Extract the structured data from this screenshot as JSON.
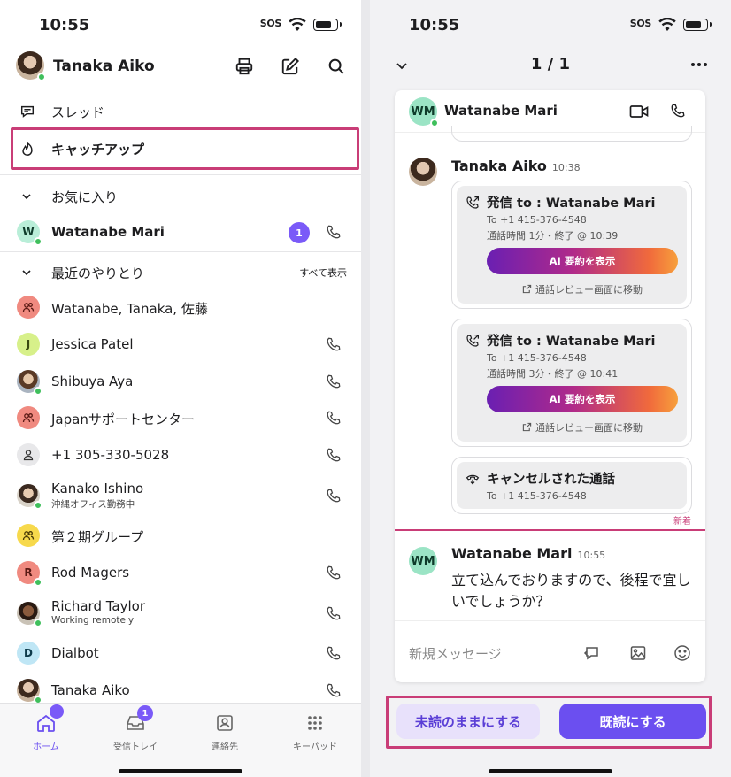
{
  "left": {
    "status": {
      "time": "10:55",
      "sos": "SOS"
    },
    "header": {
      "user_name": "Tanaka Aiko"
    },
    "nav": {
      "threads": "スレッド",
      "catchup": "キャッチアップ"
    },
    "favorites": {
      "title": "お気に入り",
      "items": [
        {
          "initial": "W",
          "name": "Watanabe Mari",
          "count": "1"
        }
      ]
    },
    "recent": {
      "title": "最近のやりとり",
      "see_all": "すべて表示",
      "items": [
        {
          "name": "Watanabe, Tanaka, 佐藤"
        },
        {
          "initial": "J",
          "name": "Jessica Patel"
        },
        {
          "name": "Shibuya Aya"
        },
        {
          "name": "Japanサポートセンター"
        },
        {
          "name": "+1 305-330-5028"
        },
        {
          "name": "Kanako Ishino",
          "sub": "沖縄オフィス勤務中"
        },
        {
          "name": "第２期グループ"
        },
        {
          "initial": "R",
          "name": "Rod Magers"
        },
        {
          "name": "Richard Taylor",
          "sub": "Working remotely"
        },
        {
          "initial": "D",
          "name": "Dialbot"
        },
        {
          "name": "Tanaka Aiko"
        }
      ]
    },
    "tabs": [
      {
        "label": "ホーム"
      },
      {
        "label": "受信トレイ",
        "badge": "1"
      },
      {
        "label": "連絡先"
      },
      {
        "label": "キーパッド"
      }
    ]
  },
  "right": {
    "status": {
      "time": "10:55",
      "sos": "SOS"
    },
    "header": {
      "page": "1 / 1"
    },
    "conversation": {
      "initials": "WM",
      "title": "Watanabe Mari"
    },
    "messages": {
      "first": {
        "sender": "Tanaka Aiko",
        "time": "10:38"
      },
      "calls": [
        {
          "title": "発信 to : Watanabe Mari",
          "to": "To +1 415-376-4548",
          "detail": "通話時間 1分・終了 @ 10:39",
          "ai_button": "AI 要約を表示",
          "review": "通話レビュー画面に移動"
        },
        {
          "title": "発信 to : Watanabe Mari",
          "to": "To +1 415-376-4548",
          "detail": "通話時間 3分・終了 @ 10:41",
          "ai_button": "AI 要約を表示",
          "review": "通話レビュー画面に移動"
        }
      ],
      "cancelled": {
        "title": "キャンセルされた通話",
        "to": "To +1 415-376-4548"
      },
      "new_label": "新着",
      "reply": {
        "initials": "WM",
        "sender": "Watanabe Mari",
        "time": "10:55",
        "text": "立て込んでおりますので、後程で宜しいでしょうか？"
      }
    },
    "composer": {
      "placeholder": "新規メッセージ"
    },
    "actions": {
      "keep_unread": "未読のままにする",
      "mark_read": "既読にする"
    }
  },
  "colors": {
    "accent": "#6b4ff0",
    "highlight": "#c93d77",
    "presence": "#3fbf5c"
  }
}
